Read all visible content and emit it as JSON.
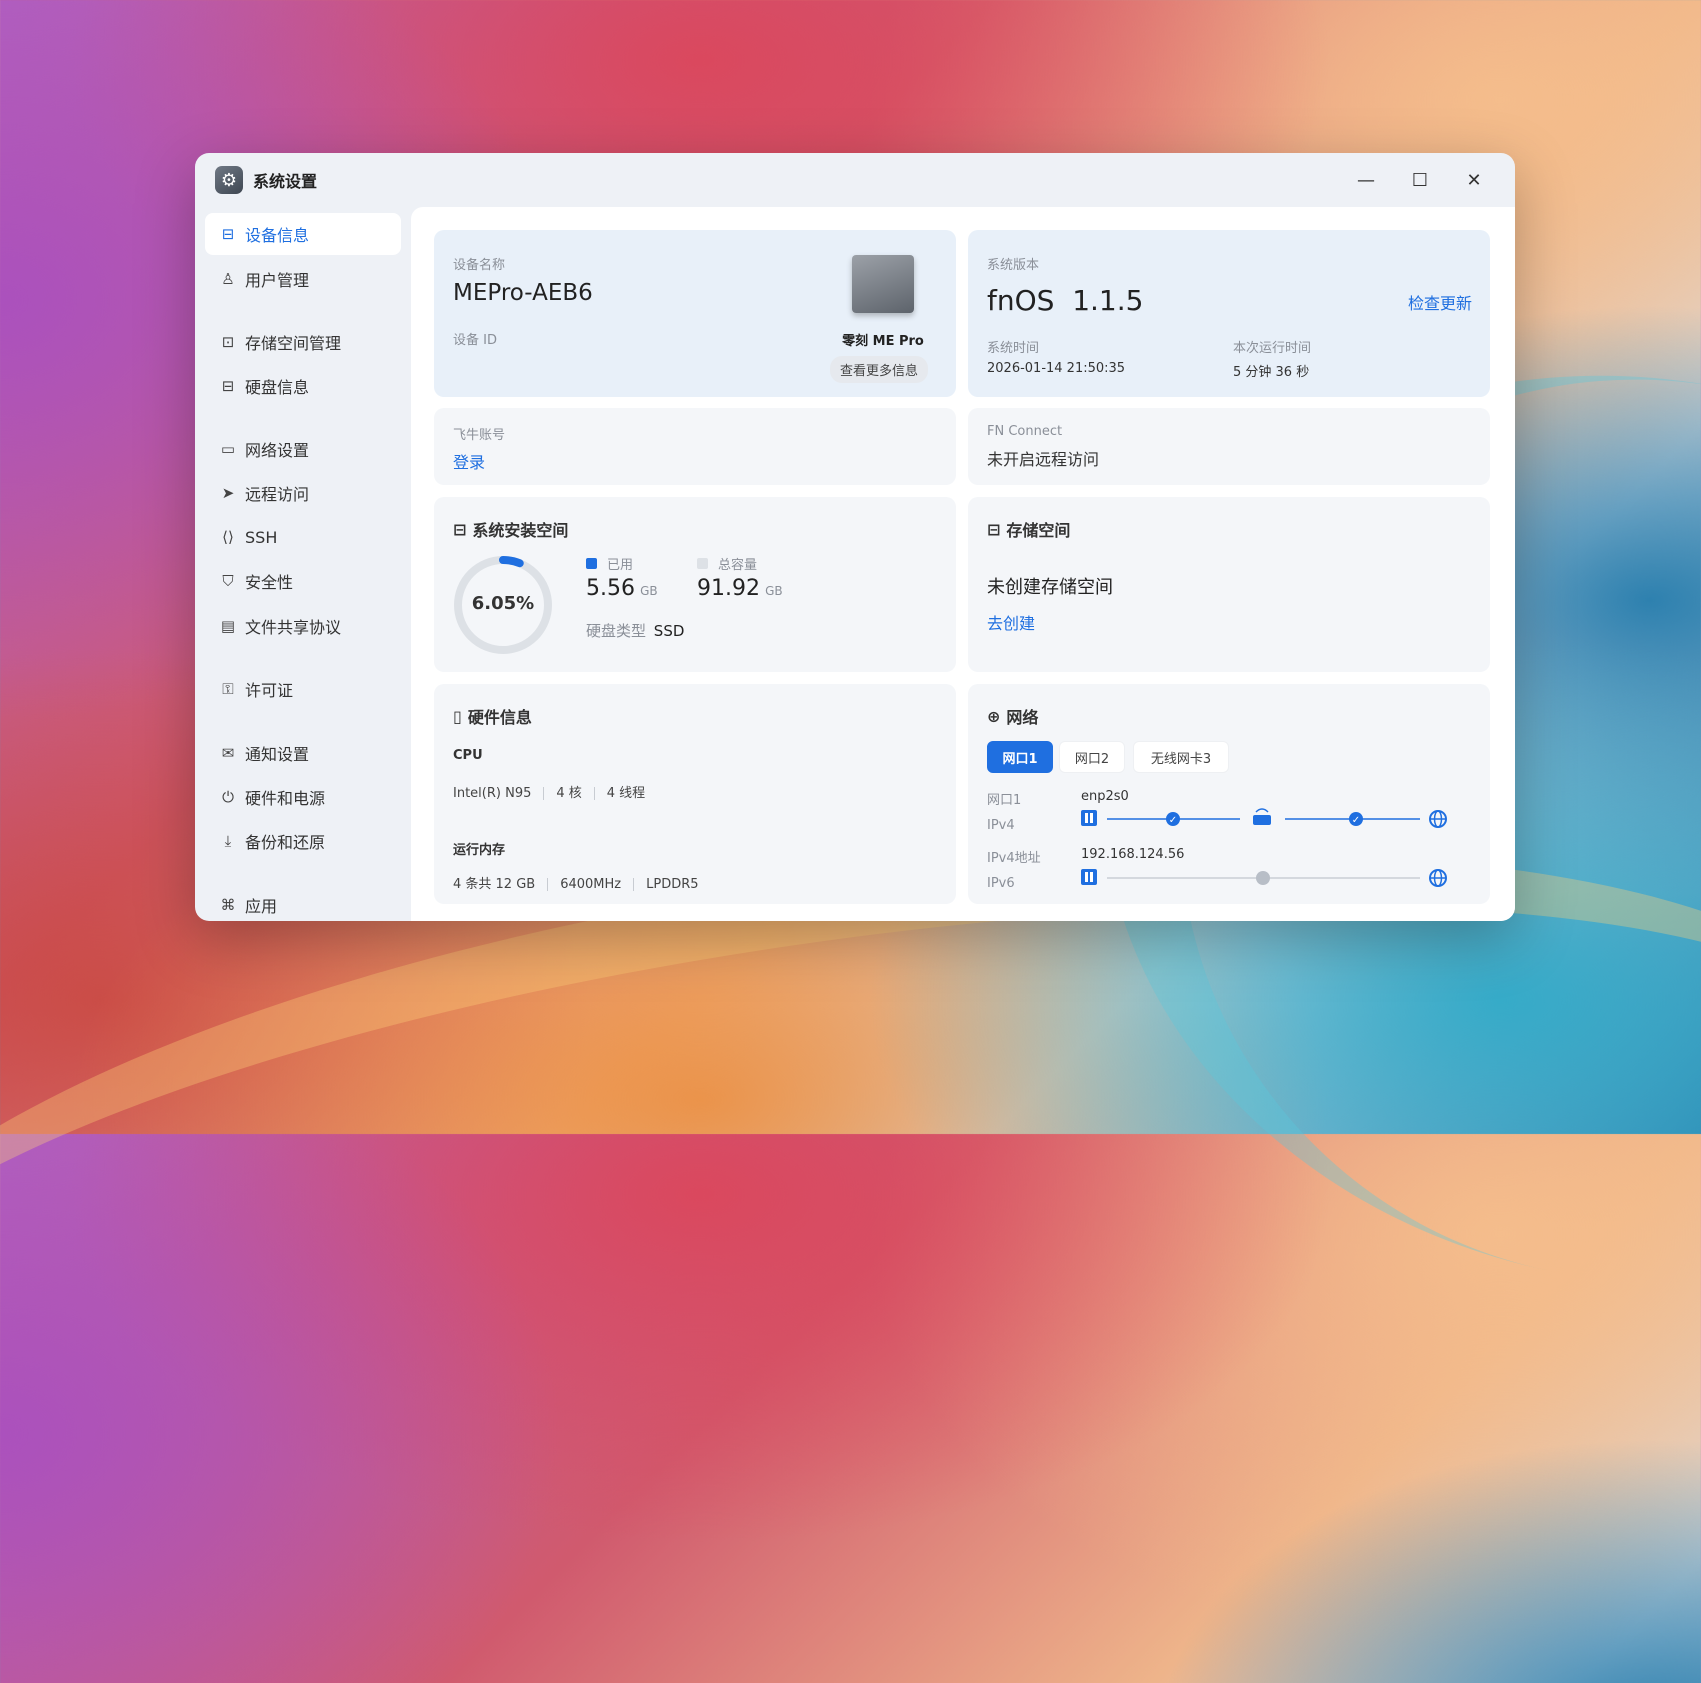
{
  "window": {
    "title": "系统设置"
  },
  "controls": {
    "minimize": "—",
    "maximize": "☐",
    "close": "✕"
  },
  "sidebar": {
    "items": [
      {
        "label": "设备信息",
        "icon": "drive-icon",
        "glyph": "⊟"
      },
      {
        "label": "用户管理",
        "icon": "users-icon",
        "glyph": "♙"
      },
      {
        "label": "存储空间管理",
        "icon": "storage-icon",
        "glyph": "⊡"
      },
      {
        "label": "硬盘信息",
        "icon": "disk-icon",
        "glyph": "⊟"
      },
      {
        "label": "网络设置",
        "icon": "network-icon",
        "glyph": "▭"
      },
      {
        "label": "远程访问",
        "icon": "send-icon",
        "glyph": "➤"
      },
      {
        "label": "SSH",
        "icon": "terminal-icon",
        "glyph": "⟨⟩"
      },
      {
        "label": "安全性",
        "icon": "shield-icon",
        "glyph": "⛉"
      },
      {
        "label": "文件共享协议",
        "icon": "file-icon",
        "glyph": "▤"
      },
      {
        "label": "许可证",
        "icon": "key-icon",
        "glyph": "⚿"
      },
      {
        "label": "通知设置",
        "icon": "mail-icon",
        "glyph": "✉"
      },
      {
        "label": "硬件和电源",
        "icon": "power-icon",
        "glyph": "⏻"
      },
      {
        "label": "备份和还原",
        "icon": "download-icon",
        "glyph": "⤓"
      },
      {
        "label": "应用",
        "icon": "apps-icon",
        "glyph": "⌘"
      }
    ]
  },
  "device": {
    "name_label": "设备名称",
    "name": "MEPro-AEB6",
    "id_label": "设备 ID",
    "model": "零刻 ME Pro",
    "more_button": "查看更多信息"
  },
  "system": {
    "version_label": "系统版本",
    "version": "fnOS  1.1.5",
    "update_link": "检查更新",
    "time_label": "系统时间",
    "time": "2026-01-14 21:50:35",
    "uptime_label": "本次运行时间",
    "uptime": "5 分钟 36 秒"
  },
  "account": {
    "label": "飞牛账号",
    "login": "登录"
  },
  "fnconnect": {
    "label": "FN Connect",
    "status": "未开启远程访问"
  },
  "install_space": {
    "title": "系统安装空间",
    "percent": "6.05%",
    "percent_value": 6.05,
    "used_label": "已用",
    "used_value": "5.56",
    "used_unit": "GB",
    "total_label": "总容量",
    "total_value": "91.92",
    "total_unit": "GB",
    "disk_type_label": "硬盘类型",
    "disk_type": "SSD",
    "used_color": "#1f6fe0",
    "track_color": "#dde1e6"
  },
  "storage": {
    "title": "存储空间",
    "status": "未创建存储空间",
    "create_link": "去创建"
  },
  "hardware": {
    "title": "硬件信息",
    "cpu_label": "CPU",
    "cpu_model": "Intel(R) N95",
    "cpu_cores": "4 核",
    "cpu_threads": "4 线程",
    "mem_label": "运行内存",
    "mem_slots": "4 条共 12 GB",
    "mem_speed": "6400MHz",
    "mem_type": "LPDDR5"
  },
  "network": {
    "title": "网络",
    "tabs": [
      "网口1",
      "网口2",
      "无线网卡3"
    ],
    "port_label": "网口1",
    "port_value": "enp2s0",
    "ipv4_label": "IPv4",
    "ipv4_addr_label": "IPv4地址",
    "ipv4_addr": "192.168.124.56",
    "ipv6_label": "IPv6"
  }
}
